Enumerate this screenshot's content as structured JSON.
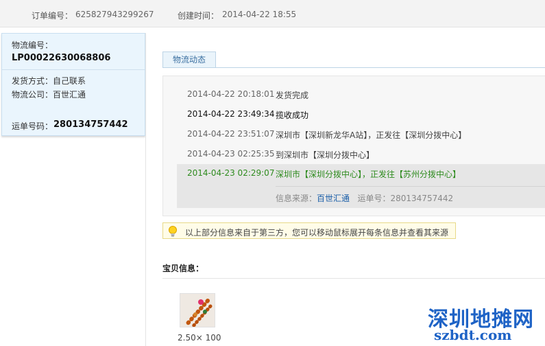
{
  "order": {
    "number_label": "订单编号：",
    "number": "625827943299267",
    "created_label": "创建时间：",
    "created": "2014-04-22 18:55"
  },
  "logistics": {
    "id_label": "物流编号：",
    "id": "LP00022630068806",
    "ship_method": "发货方式：自己联系",
    "company": "物流公司：百世汇通",
    "waybill_label": "运单号码：",
    "waybill": "280134757442"
  },
  "tab": {
    "label": "物流动态"
  },
  "tracking": [
    {
      "time": "2014-04-22 20:18:01",
      "desc": "发货完成",
      "style": "normal"
    },
    {
      "time": "2014-04-22 23:49:34",
      "desc": "揽收成功",
      "style": "bold"
    },
    {
      "time": "2014-04-22 23:51:07",
      "desc": "深圳市【深圳新龙华A站】，正发往【深圳分拨中心】",
      "style": "normal"
    },
    {
      "time": "2014-04-23 02:25:35",
      "desc": "到深圳市【深圳分拨中心】",
      "style": "normal"
    },
    {
      "time": "2014-04-23 02:29:07",
      "desc": "深圳市【深圳分拨中心】，正发往【苏州分拨中心】",
      "style": "green"
    }
  ],
  "source": {
    "label": "信息来源：",
    "company": "百世汇通",
    "waybill_label": "运单号：",
    "waybill": "280134757442"
  },
  "notice": {
    "text": "以上部分信息来自于第三方，您可以移动鼠标展开每条信息并查看其来源"
  },
  "goods": {
    "title": "宝贝信息：",
    "price": "2.50× 100"
  },
  "watermark": {
    "cn": "深圳地摊网",
    "en": "szbdt.com"
  },
  "colors": {
    "accent_blue": "#1e63c6",
    "green": "#2e8b1e",
    "link": "#1a5ea8"
  }
}
